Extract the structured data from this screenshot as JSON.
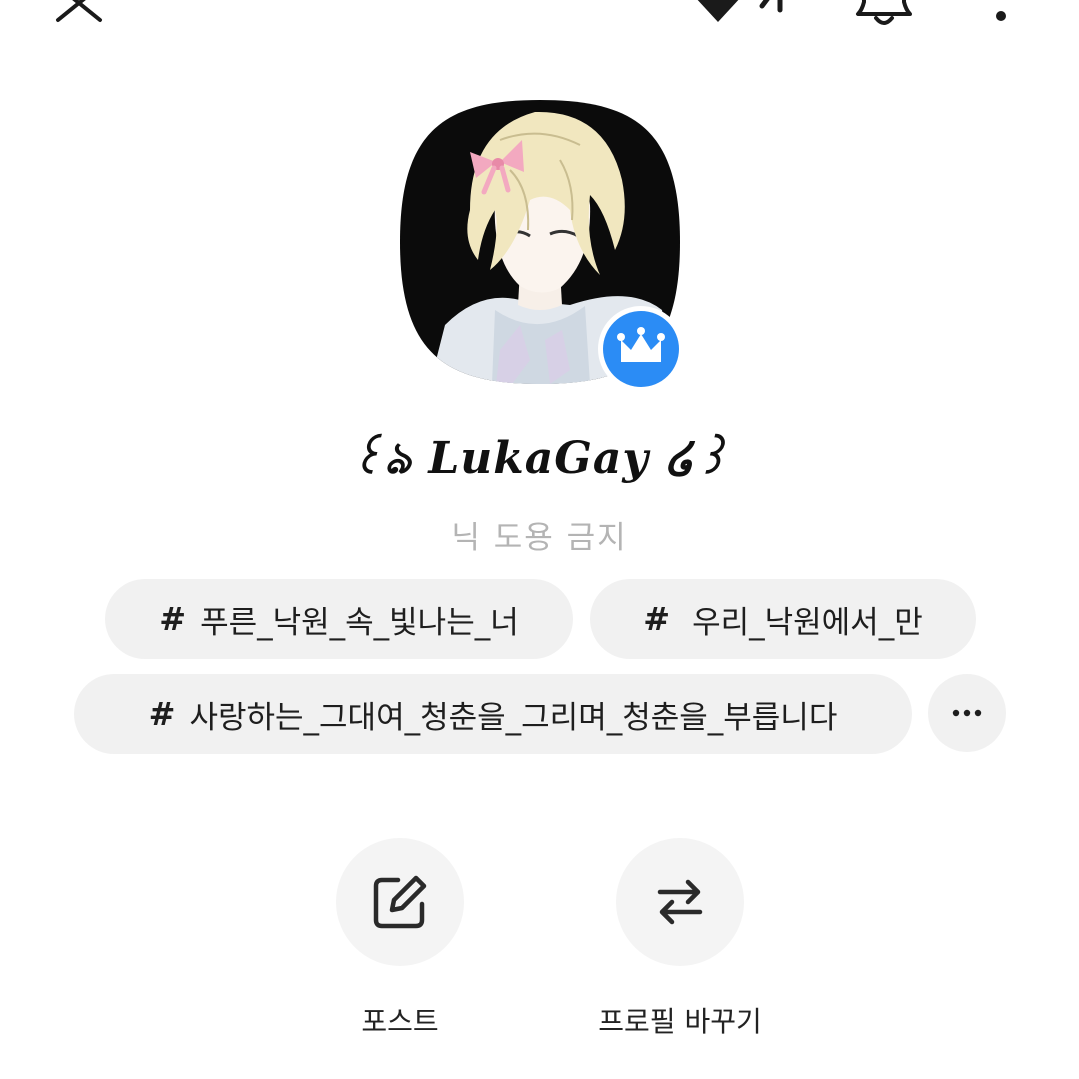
{
  "colors": {
    "background": "#ffffff",
    "chip_background": "#f1f1f1",
    "bio_text": "#b4b4b4",
    "badge_blue": "#2b8cf5",
    "text": "#1a1a1a"
  },
  "header": {
    "icons": [
      "close-icon",
      "diamond-icon",
      "bell-icon",
      "more-vertical-icon"
    ]
  },
  "profile": {
    "nickname": "꒰ঌ LukaGay ໒꒱",
    "bio": "닉 도용 금지",
    "badge_icon": "crown-icon"
  },
  "tags": [
    {
      "hash": "#",
      "label": "푸른_낙원_속_빛나는_너"
    },
    {
      "hash": "#",
      "label": "우리_낙원에서_만"
    },
    {
      "hash": "#",
      "label": "사랑하는_그대여_청춘을_그리며_청춘을_부릅니다"
    }
  ],
  "tags_more_icon": "more-horizontal-icon",
  "actions": [
    {
      "label": "포스트",
      "icon": "edit-icon"
    },
    {
      "label": "프로필 바꾸기",
      "icon": "swap-icon"
    }
  ]
}
